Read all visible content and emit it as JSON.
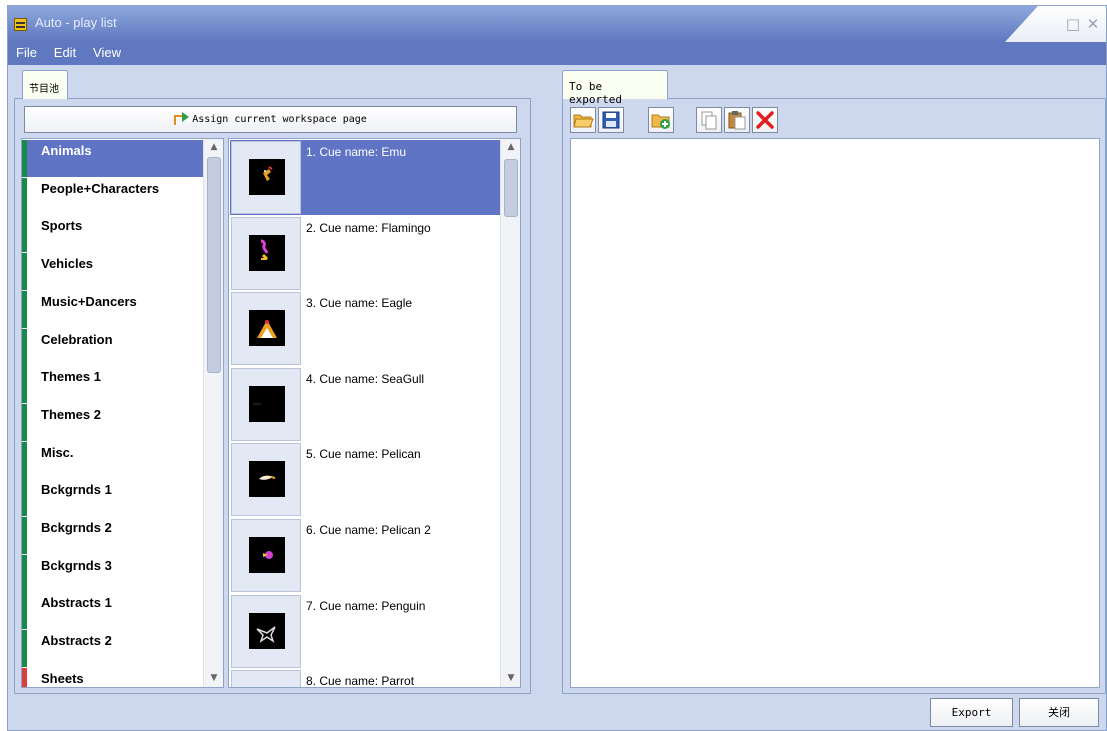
{
  "window": {
    "title": "Auto - play list"
  },
  "menu": [
    "File",
    "Edit",
    "View"
  ],
  "left_tab": {
    "label": "节目池"
  },
  "assign_button": {
    "label": "Assign current workspace page"
  },
  "categories": [
    {
      "label": "Animals",
      "selected": true,
      "color": "#198a4a"
    },
    {
      "label": "People+Characters",
      "color": "#198a4a"
    },
    {
      "label": "Sports",
      "color": "#198a4a"
    },
    {
      "label": "Vehicles",
      "color": "#198a4a"
    },
    {
      "label": "Music+Dancers",
      "color": "#198a4a"
    },
    {
      "label": "Celebration",
      "color": "#198a4a"
    },
    {
      "label": "Themes 1",
      "color": "#198a4a"
    },
    {
      "label": "Themes 2",
      "color": "#198a4a"
    },
    {
      "label": "Misc.",
      "color": "#198a4a"
    },
    {
      "label": "Bckgrnds 1",
      "color": "#198a4a"
    },
    {
      "label": "Bckgrnds 2",
      "color": "#198a4a"
    },
    {
      "label": "Bckgrnds 3",
      "color": "#198a4a"
    },
    {
      "label": "Abstracts 1",
      "color": "#198a4a"
    },
    {
      "label": "Abstracts 2",
      "color": "#198a4a"
    },
    {
      "label": "Sheets",
      "color": "#d84040"
    }
  ],
  "cues": [
    {
      "label": "1. Cue name: Emu",
      "selected": true
    },
    {
      "label": "2. Cue name: Flamingo"
    },
    {
      "label": "3. Cue name: Eagle"
    },
    {
      "label": "4. Cue name: SeaGull"
    },
    {
      "label": "5. Cue name: Pelican"
    },
    {
      "label": "6. Cue name: Pelican 2"
    },
    {
      "label": "7. Cue name: Penguin"
    },
    {
      "label": "8. Cue name: Parrot"
    }
  ],
  "right_tab": {
    "label": "To be exported"
  },
  "toolbar": [
    "open-folder-icon",
    "save-icon",
    "add-folder-icon",
    "copy-icon",
    "paste-icon",
    "delete-icon"
  ],
  "footer": {
    "export_label": "Export",
    "close_label": "关闭"
  },
  "colors": {
    "accent": "#5f78bf",
    "selection": "#5f74c4",
    "background": "#cdd8ee"
  }
}
